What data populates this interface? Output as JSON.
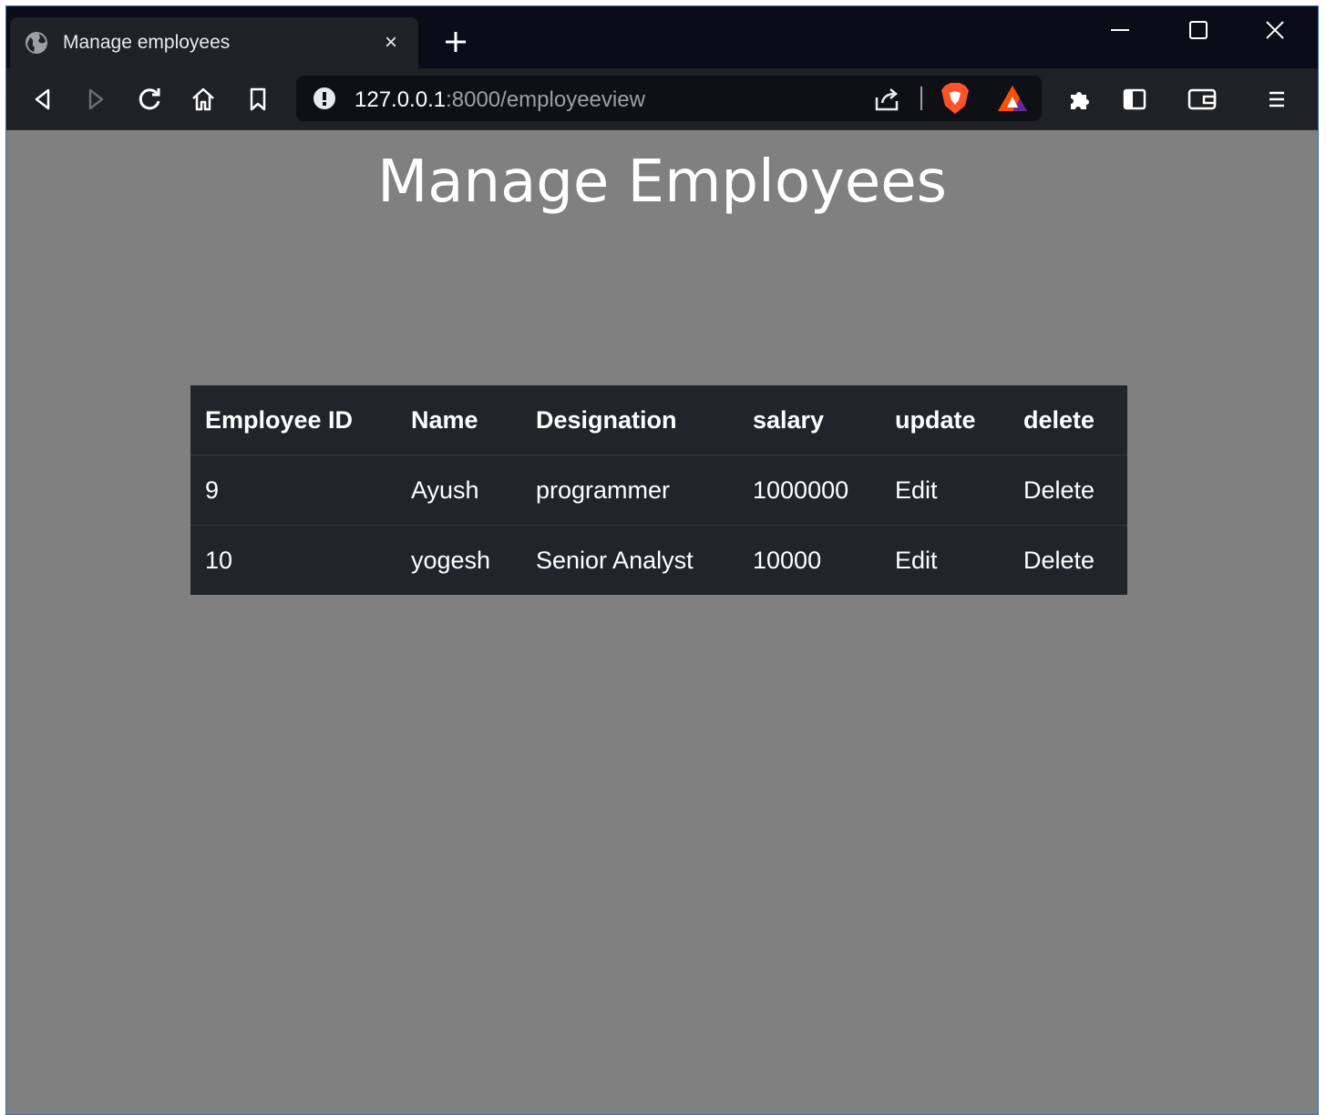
{
  "browser": {
    "tab_title": "Manage employees",
    "tab_close": "×",
    "url_host": "127.0.0.1",
    "url_path": ":8000/employeeview"
  },
  "page": {
    "heading": "Manage Employees"
  },
  "table": {
    "headers": [
      "Employee ID",
      "Name",
      "Designation",
      "salary",
      "update",
      "delete"
    ],
    "rows": [
      {
        "id": "9",
        "name": "Ayush",
        "designation": "programmer",
        "salary": "1000000",
        "update": "Edit",
        "delete": "Delete"
      },
      {
        "id": "10",
        "name": "yogesh",
        "designation": "Senior Analyst",
        "salary": "10000",
        "update": "Edit",
        "delete": "Delete"
      }
    ]
  },
  "colors": {
    "page_bg": "#808080",
    "table_bg": "#212529",
    "titlebar_bg": "#0b0c17",
    "toolbar_bg": "#202124"
  }
}
